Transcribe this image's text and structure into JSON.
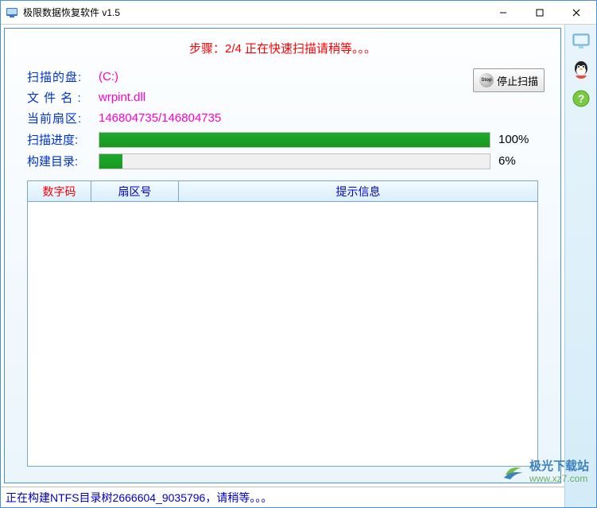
{
  "window": {
    "title": "极限数据恢复软件 v1.5"
  },
  "step_line": "步骤：2/4 正在快速扫描请稍等。。。",
  "stop_button": {
    "label": "停止扫描"
  },
  "info": {
    "disk_label": "扫描的盘:",
    "disk_value": "(C:)",
    "file_label": "文 件 名 :",
    "file_value": "wrpint.dll",
    "sector_label": "当前扇区:",
    "sector_value": "146804735/146804735"
  },
  "progress": {
    "scan_label": "扫描进度:",
    "scan_pct": 100,
    "scan_pct_text": "100%",
    "build_label": "构建目录:",
    "build_pct": 6,
    "build_pct_text": "6%"
  },
  "table": {
    "headers": {
      "c1": "数字码",
      "c2": "扇区号",
      "c3": "提示信息"
    },
    "rows": []
  },
  "status_bar": "正在构建NTFS目录树2666604_9035796，请稍等。。。",
  "side_icons": [
    "monitor-icon",
    "qq-icon",
    "help-icon"
  ],
  "watermark": {
    "name": "极光下载站",
    "url": "www.xz7.com"
  }
}
